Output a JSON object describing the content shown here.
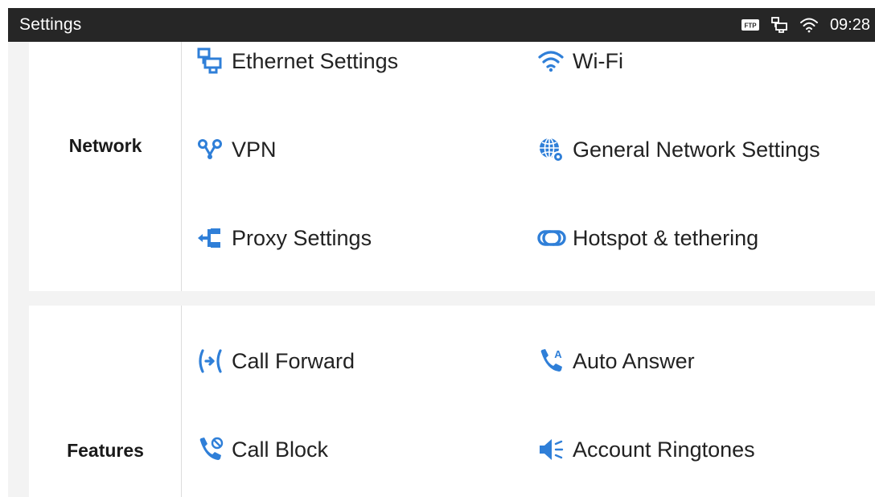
{
  "status_bar": {
    "title": "Settings",
    "time": "09:28",
    "ftp_badge": "FTP",
    "icons": [
      "ftp-icon",
      "ethernet-icon",
      "wifi-icon"
    ]
  },
  "colors": {
    "accent": "#2f7fd8",
    "status_bar_bg": "#262626",
    "page_bg": "#f3f3f3"
  },
  "sections": {
    "network": {
      "label": "Network",
      "items": [
        {
          "label": "Ethernet Settings",
          "icon": "ethernet-icon"
        },
        {
          "label": "Wi-Fi",
          "icon": "wifi-icon"
        },
        {
          "label": "VPN",
          "icon": "vpn-icon"
        },
        {
          "label": "General Network Settings",
          "icon": "globe-gear-icon"
        },
        {
          "label": "Proxy Settings",
          "icon": "proxy-icon"
        },
        {
          "label": "Hotspot & tethering",
          "icon": "hotspot-icon"
        }
      ]
    },
    "features": {
      "label": "Features",
      "items": [
        {
          "label": "Call Forward",
          "icon": "call-forward-icon"
        },
        {
          "label": "Auto Answer",
          "icon": "auto-answer-icon"
        },
        {
          "label": "Call Block",
          "icon": "call-block-icon"
        },
        {
          "label": "Account Ringtones",
          "icon": "speaker-icon"
        }
      ]
    }
  }
}
